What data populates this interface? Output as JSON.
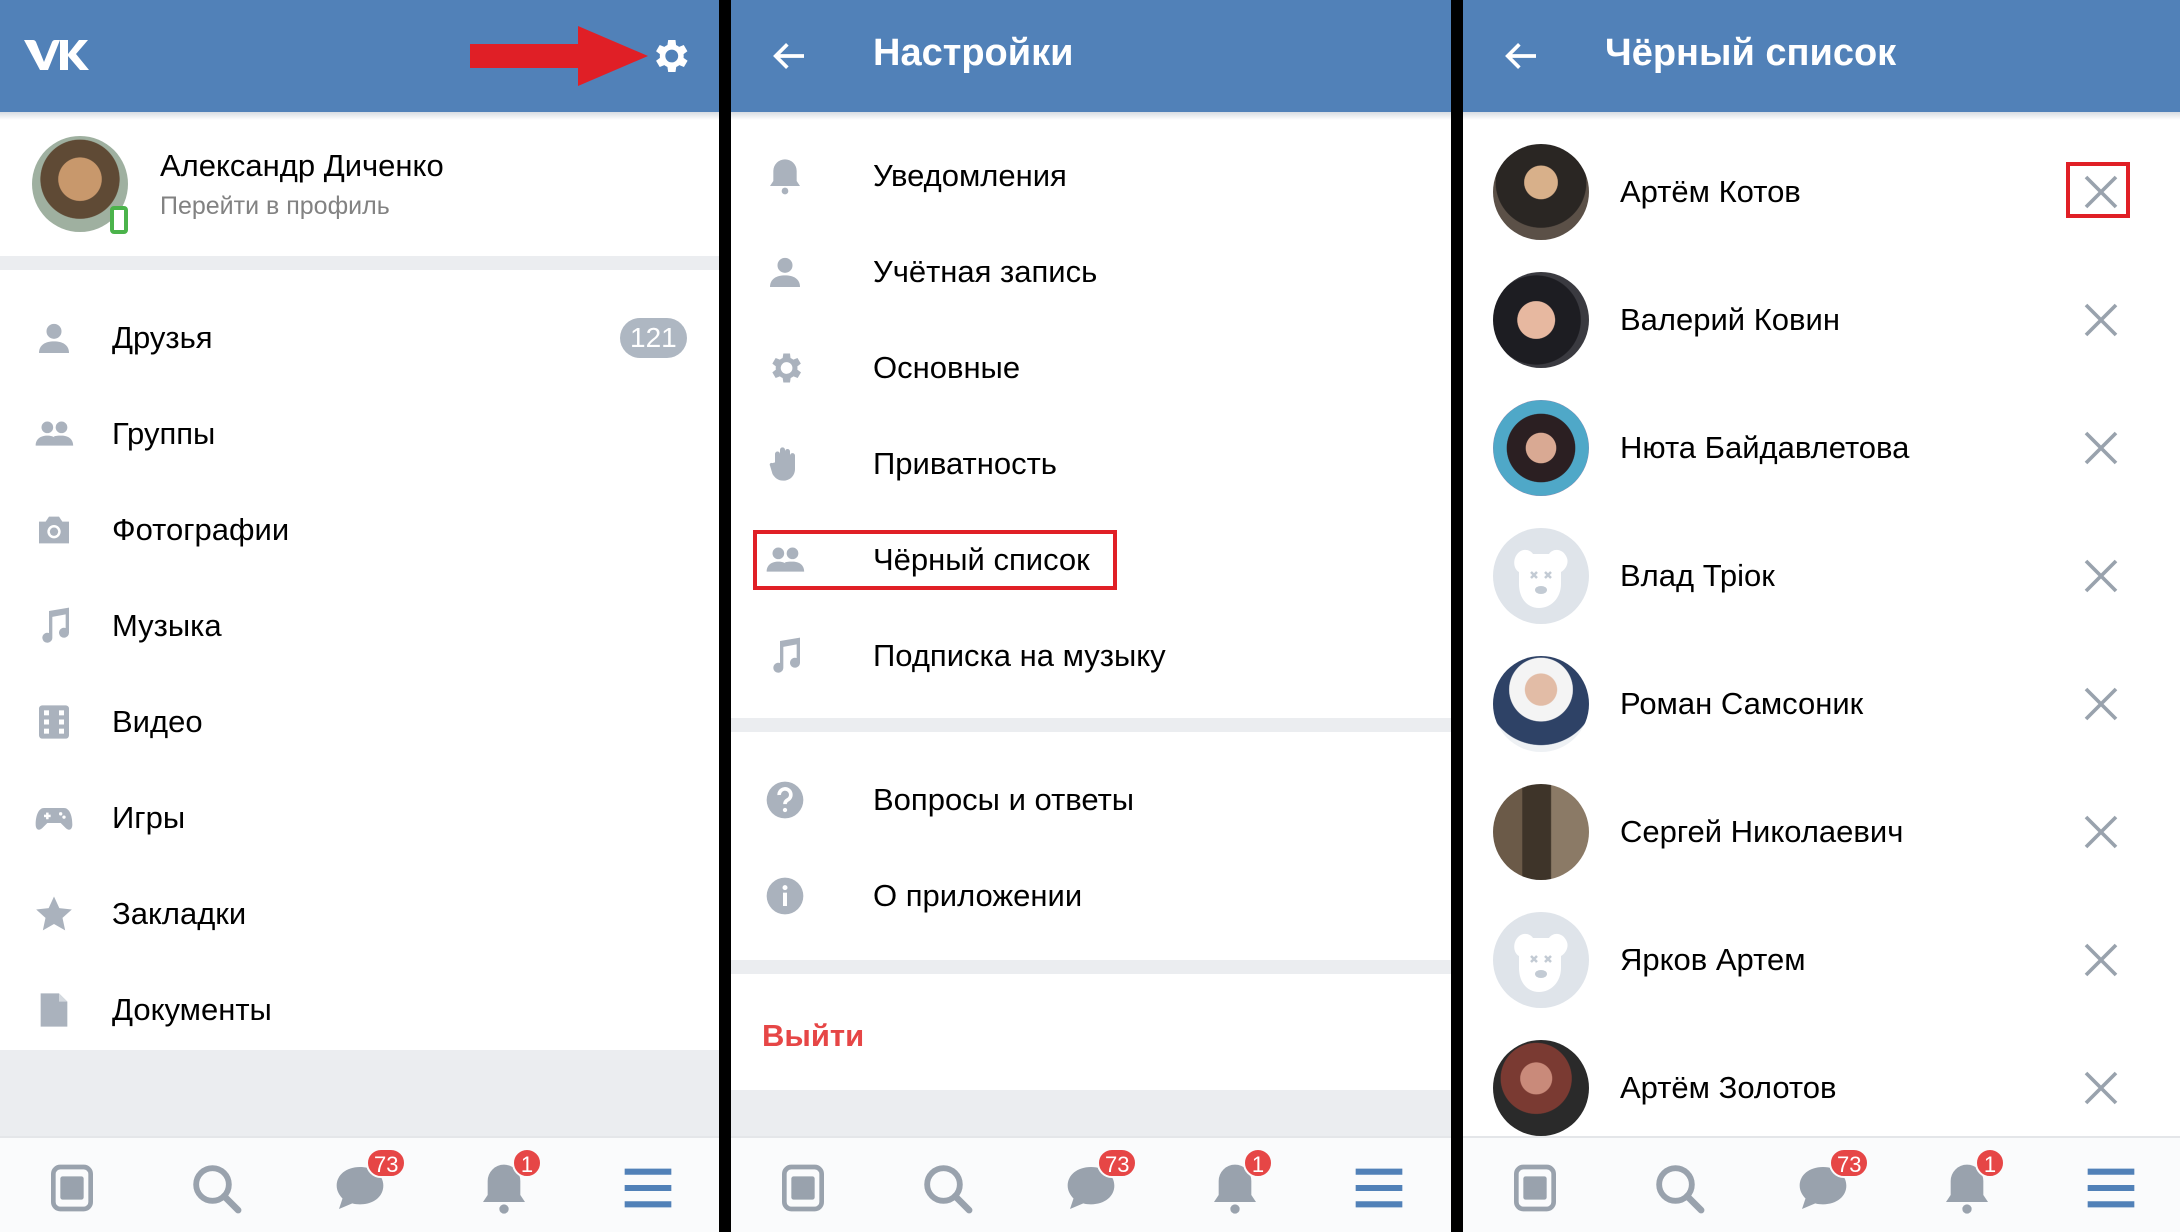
{
  "colors": {
    "header": "#5181b8",
    "accent_red": "#e64646",
    "highlight": "#e01f26",
    "icon_gray": "#aab2bd",
    "separator": "#ebedf0"
  },
  "panel1": {
    "logo": "vk-logo",
    "profile": {
      "name": "Александр Диченко",
      "subtitle": "Перейти в профиль"
    },
    "menu": [
      {
        "label": "Друзья",
        "icon": "person-icon",
        "count": "121"
      },
      {
        "label": "Группы",
        "icon": "people-icon"
      },
      {
        "label": "Фотографии",
        "icon": "camera-icon"
      },
      {
        "label": "Музыка",
        "icon": "music-note-icon"
      },
      {
        "label": "Видео",
        "icon": "film-icon"
      },
      {
        "label": "Игры",
        "icon": "gamepad-icon"
      },
      {
        "label": "Закладки",
        "icon": "star-icon"
      },
      {
        "label": "Документы",
        "icon": "document-icon"
      }
    ]
  },
  "panel2": {
    "title": "Настройки",
    "items": [
      {
        "label": "Уведомления",
        "icon": "bell-icon"
      },
      {
        "label": "Учётная запись",
        "icon": "person-icon"
      },
      {
        "label": "Основные",
        "icon": "gear-icon"
      },
      {
        "label": "Приватность",
        "icon": "hand-icon"
      },
      {
        "label": "Чёрный список",
        "icon": "people-icon"
      },
      {
        "label": "Подписка на музыку",
        "icon": "music-note-icon"
      }
    ],
    "help_items": [
      {
        "label": "Вопросы и ответы",
        "icon": "question-icon"
      },
      {
        "label": "О приложении",
        "icon": "info-icon"
      }
    ],
    "logout": "Выйти"
  },
  "panel3": {
    "title": "Чёрный список",
    "users": [
      {
        "name": "Артём Котов"
      },
      {
        "name": "Валерий Ковин"
      },
      {
        "name": "Нюта Байдавлетова"
      },
      {
        "name": "Влад Тріок",
        "deactivated": true
      },
      {
        "name": "Роман Самсоник"
      },
      {
        "name": "Сергей Николаевич"
      },
      {
        "name": "Ярков Артем",
        "deactivated": true
      },
      {
        "name": "Артём Золотов"
      }
    ]
  },
  "tabbar": {
    "tabs": [
      {
        "name": "news-icon"
      },
      {
        "name": "search-icon"
      },
      {
        "name": "messages-icon",
        "badge": "73"
      },
      {
        "name": "notifications-icon",
        "badge": "1"
      },
      {
        "name": "menu-icon"
      }
    ]
  }
}
